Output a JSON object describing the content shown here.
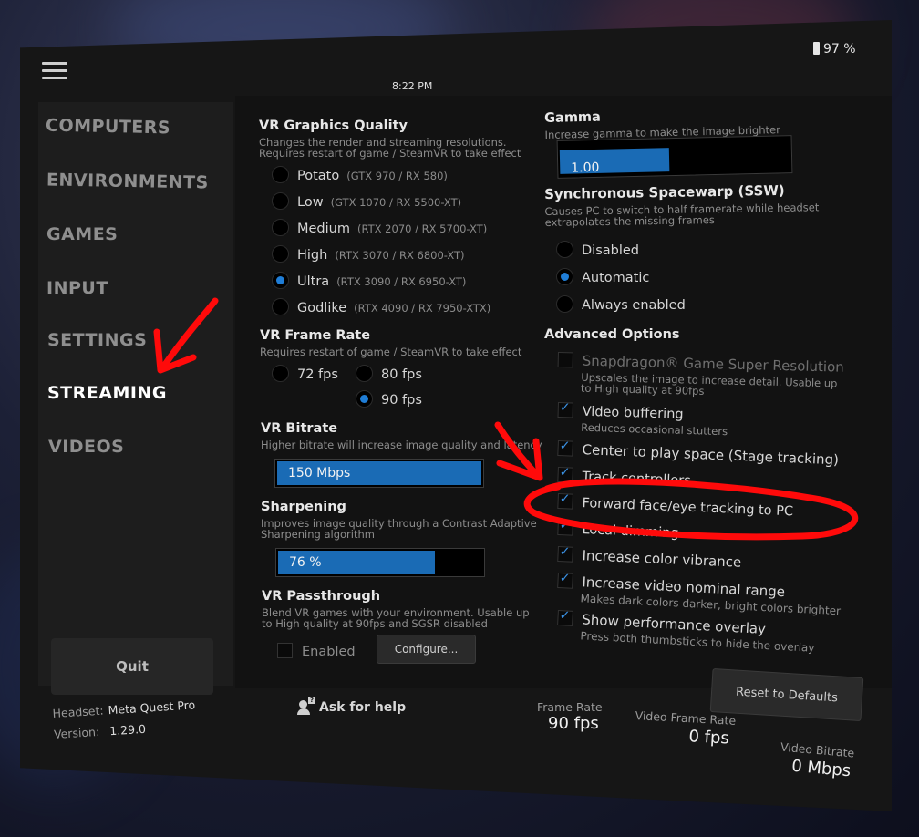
{
  "status_bar": {
    "time": "8:22 PM",
    "battery": "97 %"
  },
  "sidebar": {
    "items": [
      {
        "label": "COMPUTERS"
      },
      {
        "label": "ENVIRONMENTS"
      },
      {
        "label": "GAMES"
      },
      {
        "label": "INPUT"
      },
      {
        "label": "SETTINGS"
      },
      {
        "label": "STREAMING"
      },
      {
        "label": "VIDEOS"
      }
    ],
    "active": "STREAMING",
    "quit_label": "Quit"
  },
  "footer": {
    "headset_label": "Headset:",
    "headset_value": "Meta Quest Pro",
    "version_label": "Version:",
    "version_value": "1.29.0",
    "help_label": "Ask for help",
    "stats": {
      "frame_rate": {
        "label": "Frame Rate",
        "value": "90 fps"
      },
      "video_frame_rate": {
        "label": "Video Frame Rate",
        "value": "0 fps"
      },
      "video_bitrate": {
        "label": "Video Bitrate",
        "value": "0 Mbps"
      }
    }
  },
  "graphics": {
    "title": "VR Graphics Quality",
    "desc1": "Changes the render and streaming resolutions.",
    "desc2": "Requires restart of game / SteamVR to take effect",
    "options": [
      {
        "label": "Potato",
        "hint": "(GTX 970 / RX 580)",
        "selected": false
      },
      {
        "label": "Low",
        "hint": "(GTX 1070 / RX 5500-XT)",
        "selected": false
      },
      {
        "label": "Medium",
        "hint": "(RTX 2070 / RX 5700-XT)",
        "selected": false
      },
      {
        "label": "High",
        "hint": "(RTX 3070 / RX 6800-XT)",
        "selected": false
      },
      {
        "label": "Ultra",
        "hint": "(RTX 3090 / RX 6950-XT)",
        "selected": true
      },
      {
        "label": "Godlike",
        "hint": "(RTX 4090 / RX 7950-XTX)",
        "selected": false
      }
    ]
  },
  "frame_rate": {
    "title": "VR Frame Rate",
    "desc": "Requires restart of game / SteamVR to take effect",
    "options": [
      {
        "label": "72 fps",
        "selected": false
      },
      {
        "label": "80 fps",
        "selected": false
      },
      {
        "label": "90 fps",
        "selected": true
      }
    ]
  },
  "bitrate": {
    "title": "VR Bitrate",
    "desc": "Higher bitrate will increase image quality and latency",
    "value": "150 Mbps",
    "fill_fraction": 1.0
  },
  "sharpening": {
    "title": "Sharpening",
    "desc1": "Improves image quality through a Contrast Adaptive",
    "desc2": "Sharpening algorithm",
    "value": "76 %",
    "fill_fraction": 0.76
  },
  "passthrough": {
    "title": "VR Passthrough",
    "desc1": "Blend VR games with your environment. Usable up",
    "desc2": "to High quality at 90fps and SGSR disabled",
    "enabled_label": "Enabled",
    "enabled": false,
    "configure_label": "Configure..."
  },
  "gamma": {
    "title": "Gamma",
    "desc": "Increase gamma to make the image brighter",
    "value": "1.00",
    "fill_fraction": 0.47
  },
  "ssw": {
    "title": "Synchronous Spacewarp (SSW)",
    "desc1": "Causes PC to switch to half framerate while headset",
    "desc2": "extrapolates the missing frames",
    "options": [
      {
        "label": "Disabled",
        "selected": false
      },
      {
        "label": "Automatic",
        "selected": true
      },
      {
        "label": "Always enabled",
        "selected": false
      }
    ]
  },
  "advanced": {
    "title": "Advanced Options",
    "options": [
      {
        "label": "Snapdragon® Game Super Resolution",
        "desc1": "Upscales the image to increase detail. Usable up",
        "desc2": "to High quality at 90fps",
        "checked": false,
        "disabled": true
      },
      {
        "label": "Video buffering",
        "desc1": "Reduces occasional stutters",
        "checked": true
      },
      {
        "label": "Center to play space (Stage tracking)",
        "checked": true
      },
      {
        "label": "Track controllers",
        "checked": true
      },
      {
        "label": "Forward face/eye tracking to PC",
        "checked": true
      },
      {
        "label": "Local dimming",
        "checked": true
      },
      {
        "label": "Increase color vibrance",
        "checked": true
      },
      {
        "label": "Increase video nominal range",
        "desc1": "Makes dark colors darker, bright colors brighter",
        "checked": true
      },
      {
        "label": "Show performance overlay",
        "desc1": "Press both thumbsticks to hide the overlay",
        "checked": true
      }
    ],
    "reset_label": "Reset to Defaults"
  },
  "colors": {
    "accent": "#1a6bb5",
    "annotation": "#ff0a0a",
    "panel": "#161616"
  }
}
